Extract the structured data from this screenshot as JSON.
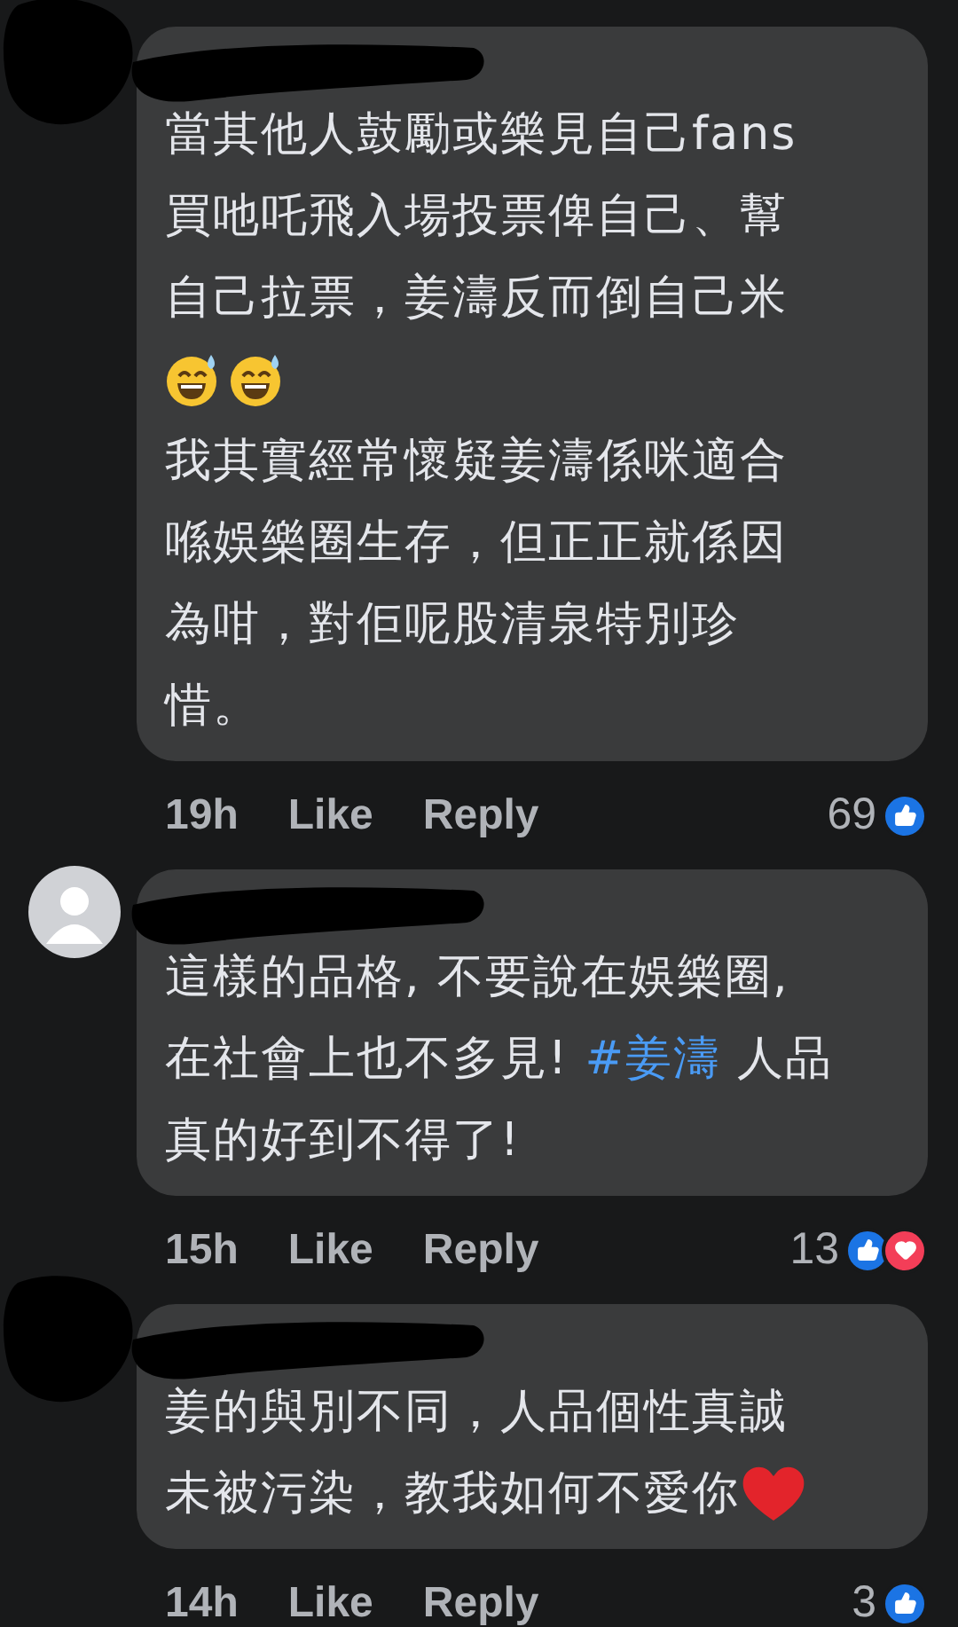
{
  "comments": [
    {
      "avatar": {
        "kind": "scribbled"
      },
      "paragraphs": [
        {
          "lines": [
            [
              {
                "kind": "text",
                "text": "當其他人鼓勵或樂見自己fans"
              }
            ],
            [
              {
                "kind": "text",
                "text": "買吔吒飛入場投票俾自己、幫"
              }
            ],
            [
              {
                "kind": "text",
                "text": "自己拉票，姜濤反而倒自己米"
              }
            ],
            [
              {
                "kind": "smile-emoji"
              },
              {
                "kind": "smile-emoji"
              }
            ]
          ]
        },
        {
          "lines": [
            [
              {
                "kind": "text",
                "text": "我其實經常懷疑姜濤係咪適合"
              }
            ],
            [
              {
                "kind": "text",
                "text": "喺娛樂圈生存，但正正就係因"
              }
            ],
            [
              {
                "kind": "text",
                "text": "為咁，對佢呢股清泉特別珍"
              }
            ],
            [
              {
                "kind": "text",
                "text": "惜。"
              }
            ]
          ]
        }
      ],
      "time": "19h",
      "like": "Like",
      "reply": "Reply",
      "count": "69",
      "reactions": [
        {
          "kind": "like"
        }
      ]
    },
    {
      "avatar": {
        "kind": "default"
      },
      "paragraphs": [
        {
          "lines": [
            [
              {
                "kind": "text",
                "text": "這樣的品格, 不要說在娛樂圈,"
              }
            ],
            [
              {
                "kind": "text",
                "text": "在社會上也不多見! "
              },
              {
                "kind": "hashtag",
                "text": "#姜濤"
              },
              {
                "kind": "text",
                "text": " 人品"
              }
            ],
            [
              {
                "kind": "text",
                "text": "真的好到不得了!"
              }
            ]
          ]
        }
      ],
      "time": "15h",
      "like": "Like",
      "reply": "Reply",
      "count": "13",
      "reactions": [
        {
          "kind": "like"
        },
        {
          "kind": "love"
        }
      ]
    },
    {
      "avatar": {
        "kind": "scribbled"
      },
      "paragraphs": [
        {
          "lines": [
            [
              {
                "kind": "text",
                "text": "姜的與別不同，人品個性真誠"
              }
            ],
            [
              {
                "kind": "text",
                "text": "未被污染，教我如何不愛你"
              },
              {
                "kind": "heart-emoji"
              }
            ]
          ]
        }
      ],
      "time": "14h",
      "like": "Like",
      "reply": "Reply",
      "count": "3",
      "reactions": [
        {
          "kind": "like"
        }
      ]
    }
  ]
}
